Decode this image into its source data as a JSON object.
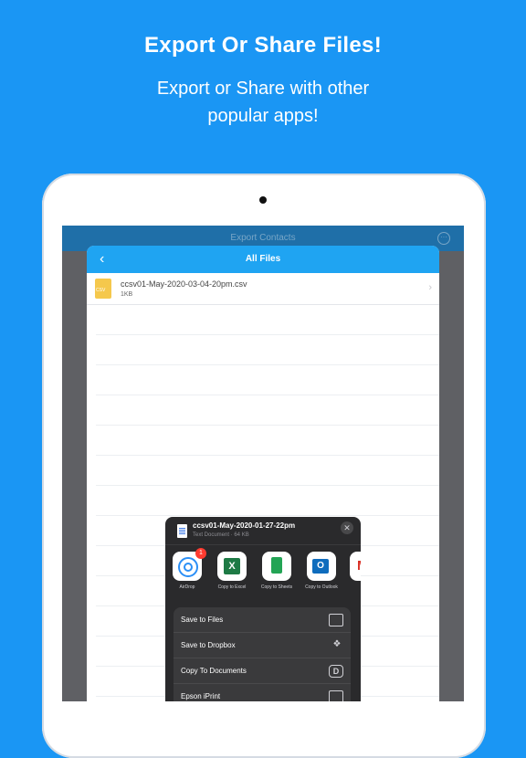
{
  "promo": {
    "title": "Export Or Share Files!",
    "subtitle_line1": "Export or Share with other",
    "subtitle_line2": "popular apps!"
  },
  "app_bar": {
    "title": "Export Contacts",
    "more_icon": "more-icon"
  },
  "files_sheet": {
    "title": "All Files",
    "back_icon": "chevron-left-icon",
    "file": {
      "name": "ccsv01-May-2020-03-04-20pm.csv",
      "size": "1KB"
    }
  },
  "share_sheet": {
    "document_name": "ccsv01-May-2020-01-27-22pm",
    "document_meta": "Text Document · 64 KB",
    "apps": [
      {
        "label": "AirDrop",
        "badge": "1"
      },
      {
        "label": "Copy to Excel"
      },
      {
        "label": "Copy to Sheets"
      },
      {
        "label": "Copy to Outlook"
      }
    ],
    "actions": [
      {
        "label": "Save to Files",
        "icon": "folder-icon"
      },
      {
        "label": "Save to Dropbox",
        "icon": "dropbox-icon"
      },
      {
        "label": "Copy To Documents",
        "icon": "documents-icon"
      },
      {
        "label": "Epson iPrint",
        "icon": "printer-icon"
      }
    ]
  }
}
